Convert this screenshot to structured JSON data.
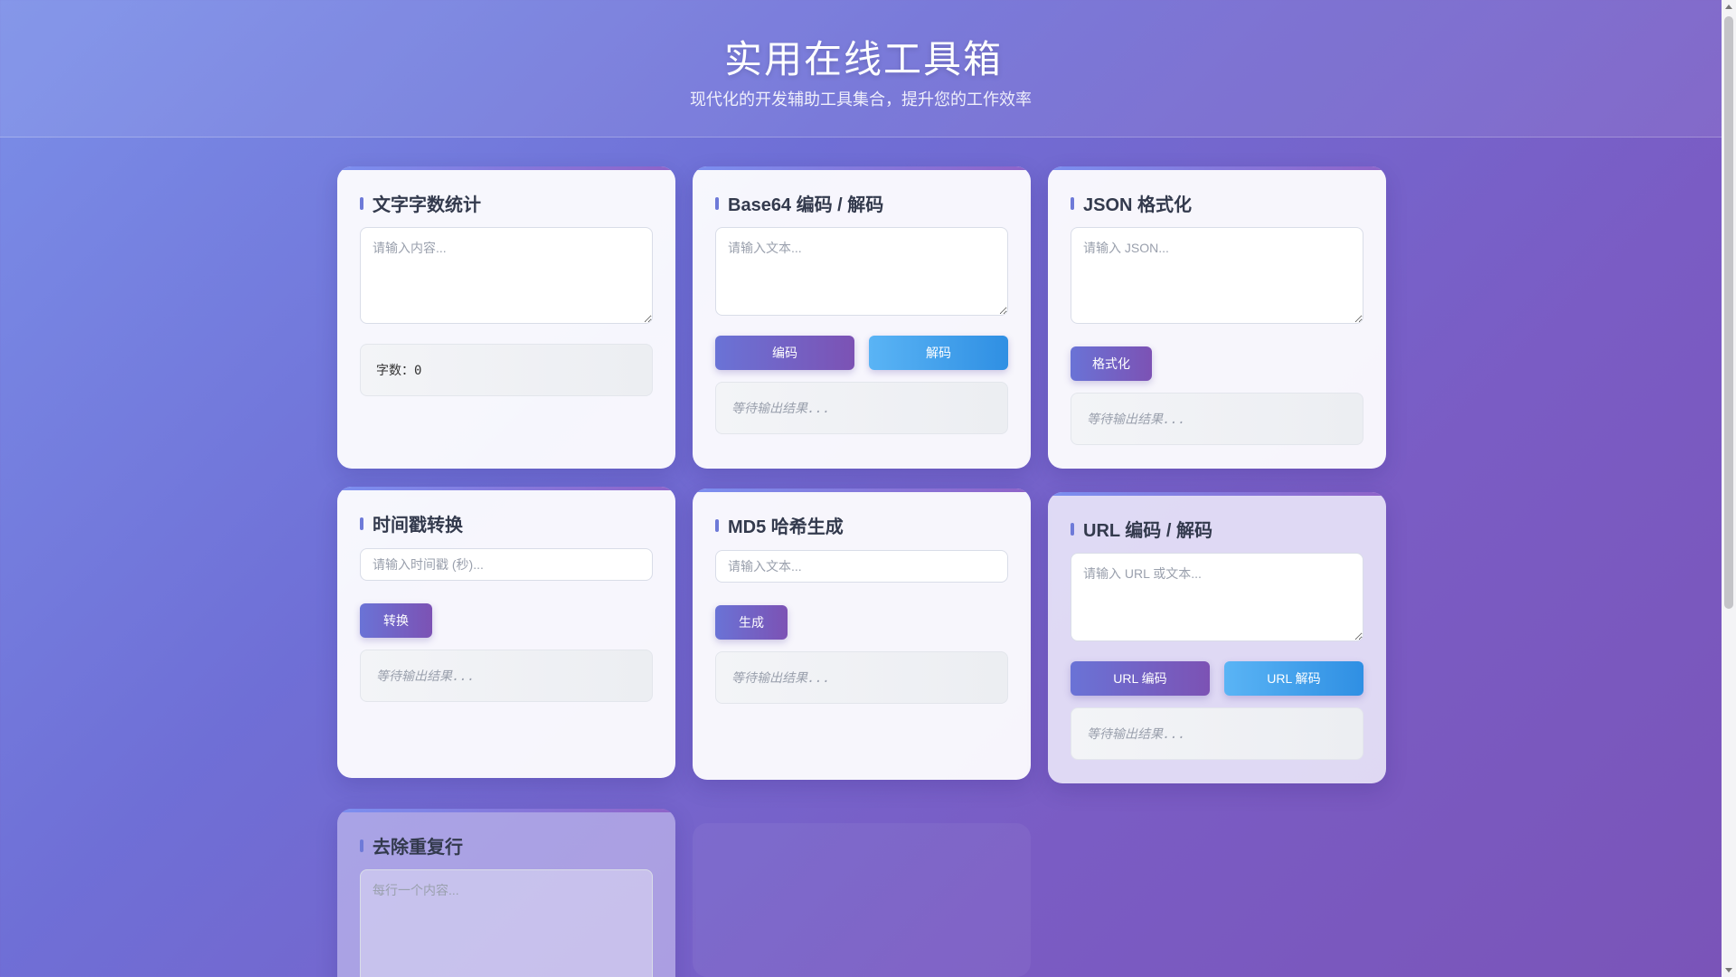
{
  "header": {
    "title_icon": "",
    "title": "实用在线工具箱",
    "subtitle": "现代化的开发辅助工具集合，提升您的工作效率"
  },
  "cards": {
    "wordcount": {
      "title": "文字字数统计",
      "placeholder": "请输入内容...",
      "result": "字数：0"
    },
    "base64": {
      "title": "Base64 编码 / 解码",
      "placeholder": "请输入文本...",
      "encode_label": "编码",
      "decode_label": "解码",
      "result": "等待输出结果..."
    },
    "json": {
      "title": "JSON 格式化",
      "placeholder": "请输入 JSON...",
      "format_label": "格式化",
      "result": "等待输出结果..."
    },
    "timestamp": {
      "title": "时间戳转换",
      "placeholder": "请输入时间戳 (秒)...",
      "convert_label": "转换",
      "result": "等待输出结果..."
    },
    "md5": {
      "title": "MD5 哈希生成",
      "placeholder": "请输入文本...",
      "generate_label": "生成",
      "result": "等待输出结果..."
    },
    "url": {
      "title": "URL 编码 / 解码",
      "placeholder": "请输入 URL 或文本...",
      "encode_label": "URL 编码",
      "decode_label": "URL 解码",
      "result": "等待输出结果..."
    },
    "dedupe": {
      "title": "去除重复行",
      "placeholder": "每行一个内容..."
    }
  },
  "colors": {
    "accent_primary": "#6a73d6",
    "accent_secondary": "#2f8fe3"
  }
}
